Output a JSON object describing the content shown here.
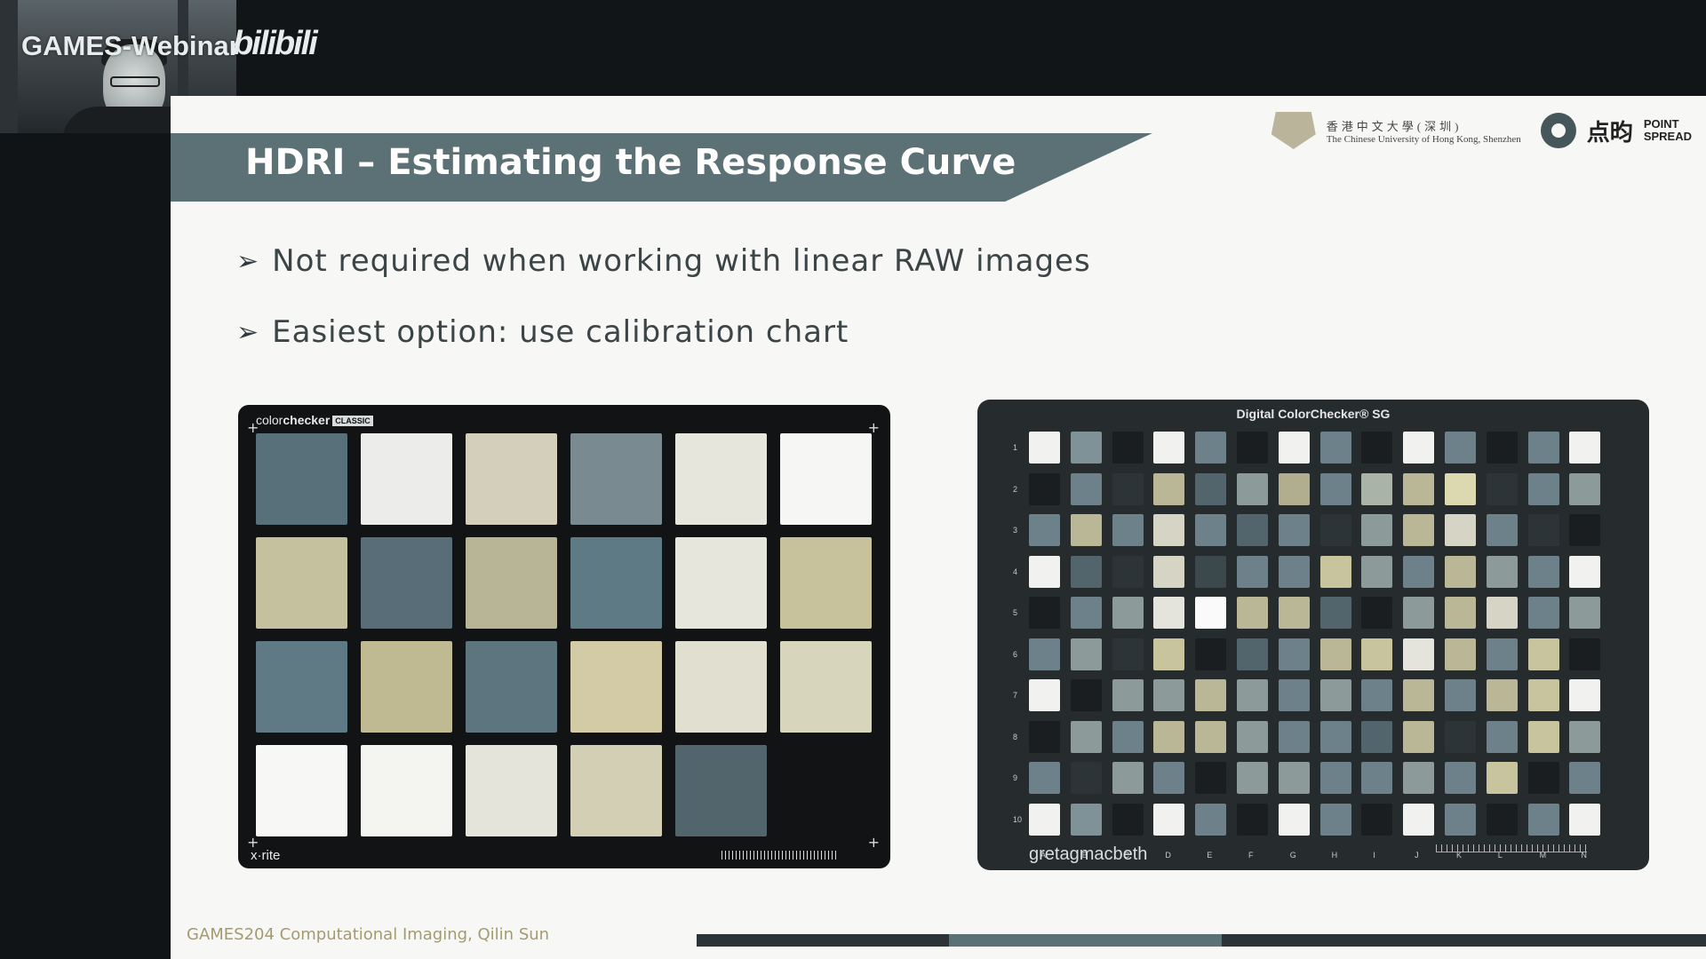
{
  "window": {
    "brand": "GAMES-Webinar",
    "platform": "bilibili"
  },
  "slide": {
    "title": "HDRI – Estimating the Response Curve",
    "logos": {
      "cuhk_cn": "香港中文大學(深圳)",
      "cuhk_en": "The Chinese University of Hong Kong, Shenzhen",
      "pointspread_cn": "点昀",
      "pointspread_en_1": "POINT",
      "pointspread_en_2": "SPREAD"
    },
    "bullets": [
      "Not required when working with linear RAW images",
      "Easiest option: use calibration chart"
    ],
    "left_chart": {
      "brand_light": "color",
      "brand_bold": "checker",
      "tag": "CLASSIC",
      "maker": "x·rite",
      "patch_colors": [
        "#58707a",
        "#ecedea",
        "#d3cfba",
        "#798b90",
        "#e7e6dc",
        "#f6f7f5",
        "#c5c19e",
        "#586d77",
        "#b8b597",
        "#5e7a84",
        "#e6e6dc",
        "#c7c29c",
        "#5f7a84",
        "#bfba92",
        "#5c757e",
        "#d2cba5",
        "#e0dfd0",
        "#d8d5bd",
        "#f7f7f5",
        "#f4f4f1",
        "#e5e4db",
        "#d3cfb4",
        "#52656c",
        "#121314"
      ]
    },
    "right_chart": {
      "title": "Digital ColorChecker® SG",
      "maker": "gretagmacbeth",
      "row_labels": [
        "1",
        "2",
        "3",
        "4",
        "5",
        "6",
        "7",
        "8",
        "9",
        "10"
      ],
      "col_labels": [
        "A",
        "B",
        "C",
        "D",
        "E",
        "F",
        "G",
        "H",
        "I",
        "J",
        "K",
        "L",
        "M",
        "N"
      ],
      "patch_colors": [
        "#f1f2f0",
        "#7f9298",
        "#1b1e20",
        "#f1f2f0",
        "#6c8189",
        "#1b1e20",
        "#f1f2f0",
        "#6c8189",
        "#1b1e20",
        "#f1f2f0",
        "#6c8189",
        "#1b1e20",
        "#6c8189",
        "#f1f2f0",
        "#1b1e20",
        "#6c8189",
        "#2d3437",
        "#b9b795",
        "#52656c",
        "#8c9a9a",
        "#b1ae90",
        "#6c8189",
        "#aab3a8",
        "#b9b795",
        "#dcd8b0",
        "#2d3437",
        "#6c8189",
        "#8c9a9a",
        "#6c8189",
        "#b9b795",
        "#6c8189",
        "#d6d4c4",
        "#6c8189",
        "#52656c",
        "#6c8189",
        "#2d3437",
        "#8c9a9a",
        "#b9b795",
        "#d6d4c4",
        "#6c8189",
        "#2d3437",
        "#1b1e20",
        "#f1f2f0",
        "#52656c",
        "#2d3437",
        "#d6d4c4",
        "#3b484c",
        "#6c8189",
        "#6c8189",
        "#c8c49e",
        "#8c9a9a",
        "#6c8189",
        "#b9b795",
        "#8c9a9a",
        "#6c8189",
        "#f1f2f0",
        "#1b1e20",
        "#6c8189",
        "#8c9a9a",
        "#e5e4dc",
        "#fafafa",
        "#b9b795",
        "#b9b795",
        "#52656c",
        "#1b1e20",
        "#8c9a9a",
        "#b9b795",
        "#d6d4c4",
        "#6c8189",
        "#8c9a9a",
        "#6c8189",
        "#8c9a9a",
        "#2d3437",
        "#c8c49e",
        "#1b1e20",
        "#52656c",
        "#6c8189",
        "#b9b795",
        "#c8c49e",
        "#e5e4dc",
        "#b9b795",
        "#6c8189",
        "#c8c49e",
        "#1b1e20",
        "#f1f2f0",
        "#1b1e20",
        "#8c9a9a",
        "#8c9a9a",
        "#b9b795",
        "#8c9a9a",
        "#6c8189",
        "#8c9a9a",
        "#6c8189",
        "#b9b795",
        "#6c8189",
        "#b9b795",
        "#c8c49e",
        "#f1f2f0",
        "#1b1e20",
        "#8c9a9a",
        "#6c8189",
        "#b9b795",
        "#b9b795",
        "#8c9a9a",
        "#6c8189",
        "#6c8189",
        "#52656c",
        "#b9b795",
        "#2d3437",
        "#6c8189",
        "#c8c49e",
        "#8c9a9a",
        "#6c8189",
        "#2d3437",
        "#8c9a9a",
        "#6c8189",
        "#1b1e20",
        "#8c9a9a",
        "#8c9a9a",
        "#6c8189",
        "#6c8189",
        "#8c9a9a",
        "#6c8189",
        "#c8c49e",
        "#1b1e20",
        "#6c8189",
        "#f1f2f0",
        "#7f9298",
        "#1b1e20",
        "#f1f2f0",
        "#6c8189",
        "#1b1e20",
        "#f1f2f0",
        "#6c8189",
        "#1b1e20",
        "#f1f2f0",
        "#6c8189",
        "#1b1e20",
        "#6c8189",
        "#f1f2f0"
      ]
    },
    "footer": "GAMES204 Computational Imaging, Qilin Sun",
    "progress_fraction": 0.5
  }
}
